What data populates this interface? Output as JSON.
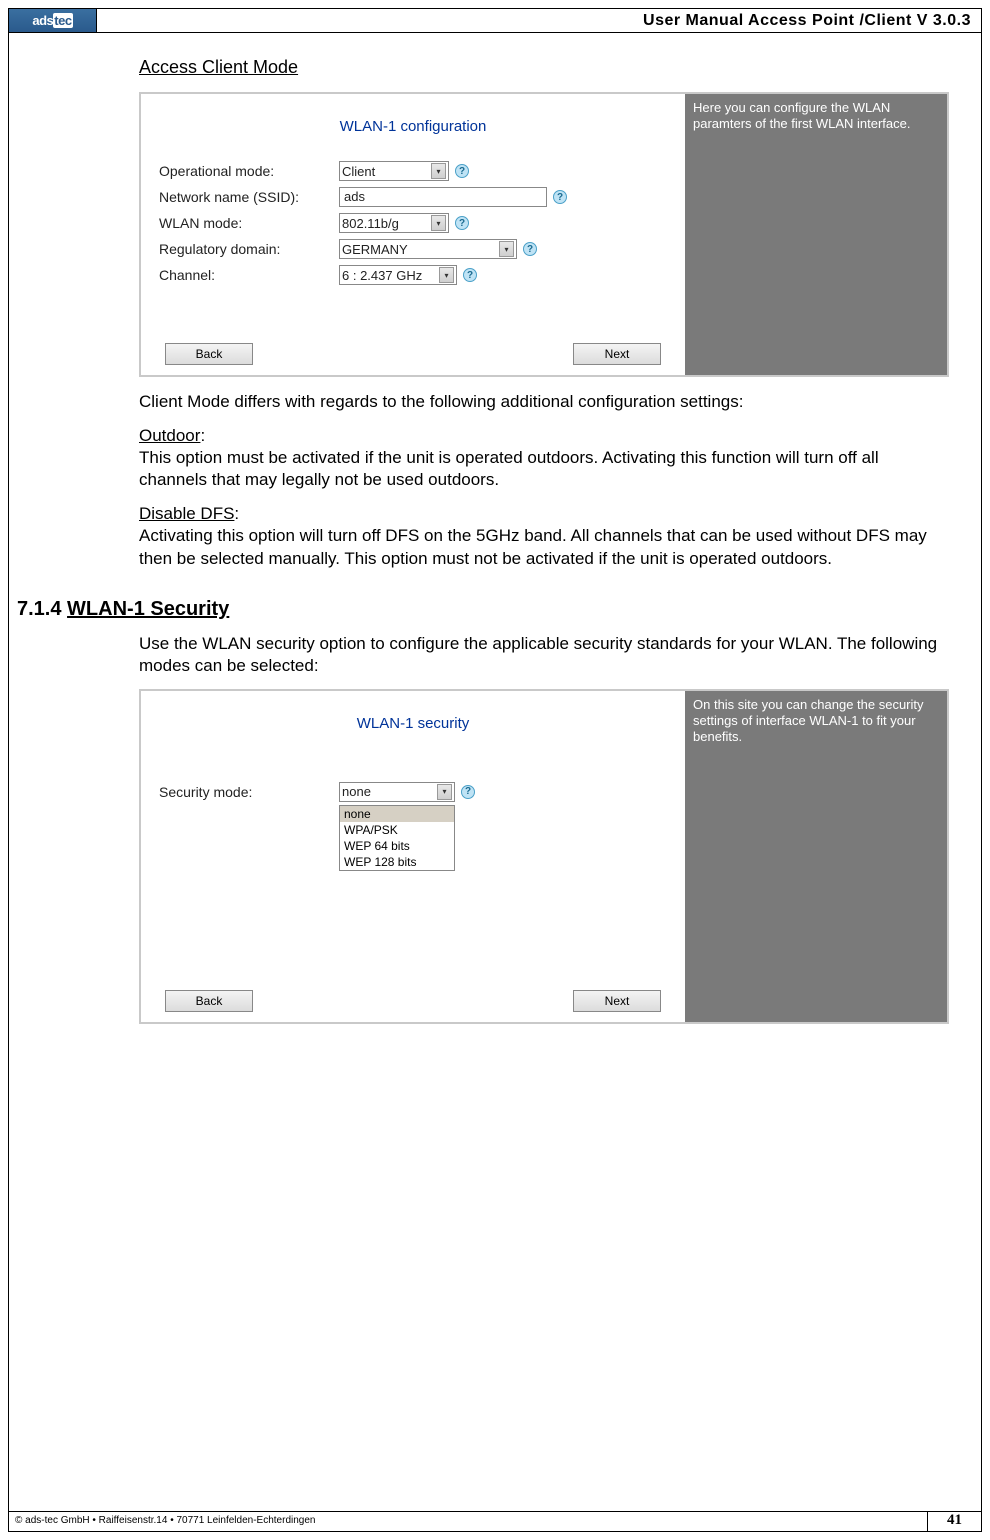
{
  "header": {
    "logo": "ads tec",
    "title": "User Manual Access  Point /Client V 3.0.3"
  },
  "section1": {
    "title": "Access Client Mode",
    "panel_title": "WLAN-1 configuration",
    "side_help": "Here you can configure the WLAN paramters of the first WLAN interface.",
    "rows": {
      "op_mode": {
        "label": "Operational mode:",
        "value": "Client"
      },
      "ssid": {
        "label": "Network name (SSID):",
        "value": "ads"
      },
      "wlan": {
        "label": "WLAN mode:",
        "value": "802.11b/g"
      },
      "reg": {
        "label": "Regulatory domain:",
        "value": "GERMANY"
      },
      "chan": {
        "label": "Channel:",
        "value": "6 : 2.437 GHz"
      }
    },
    "back": "Back",
    "next": "Next",
    "after_text": "Client Mode differs with regards to the following additional configuration settings:",
    "outdoor_h": "Outdoor",
    "outdoor_t": "This option must be activated if the unit is operated outdoors. Activating this function will turn off all channels that may legally not be used outdoors.",
    "dfs_h": "Disable DFS",
    "dfs_t": "Activating this option will turn off DFS on the 5GHz band. All channels that can be used without DFS may then be selected manually. This option must not be activated if the unit is operated outdoors."
  },
  "section2": {
    "num": "7.1.4 ",
    "title": "WLAN-1 Security",
    "intro": "Use the WLAN security option to configure the applicable security standards for your WLAN. The following modes can be selected:",
    "panel_title": "WLAN-1 security",
    "side_help": "On this site you can change the security settings of interface WLAN-1 to fit your benefits.",
    "sec_label": "Security mode:",
    "sec_value": "none",
    "options": [
      "none",
      "WPA/PSK",
      "WEP 64 bits",
      "WEP 128 bits"
    ],
    "back": "Back",
    "next": "Next"
  },
  "footer": {
    "left": "© ads-tec GmbH • Raiffeisenstr.14 • 70771 Leinfelden-Echterdingen",
    "page": "41"
  }
}
